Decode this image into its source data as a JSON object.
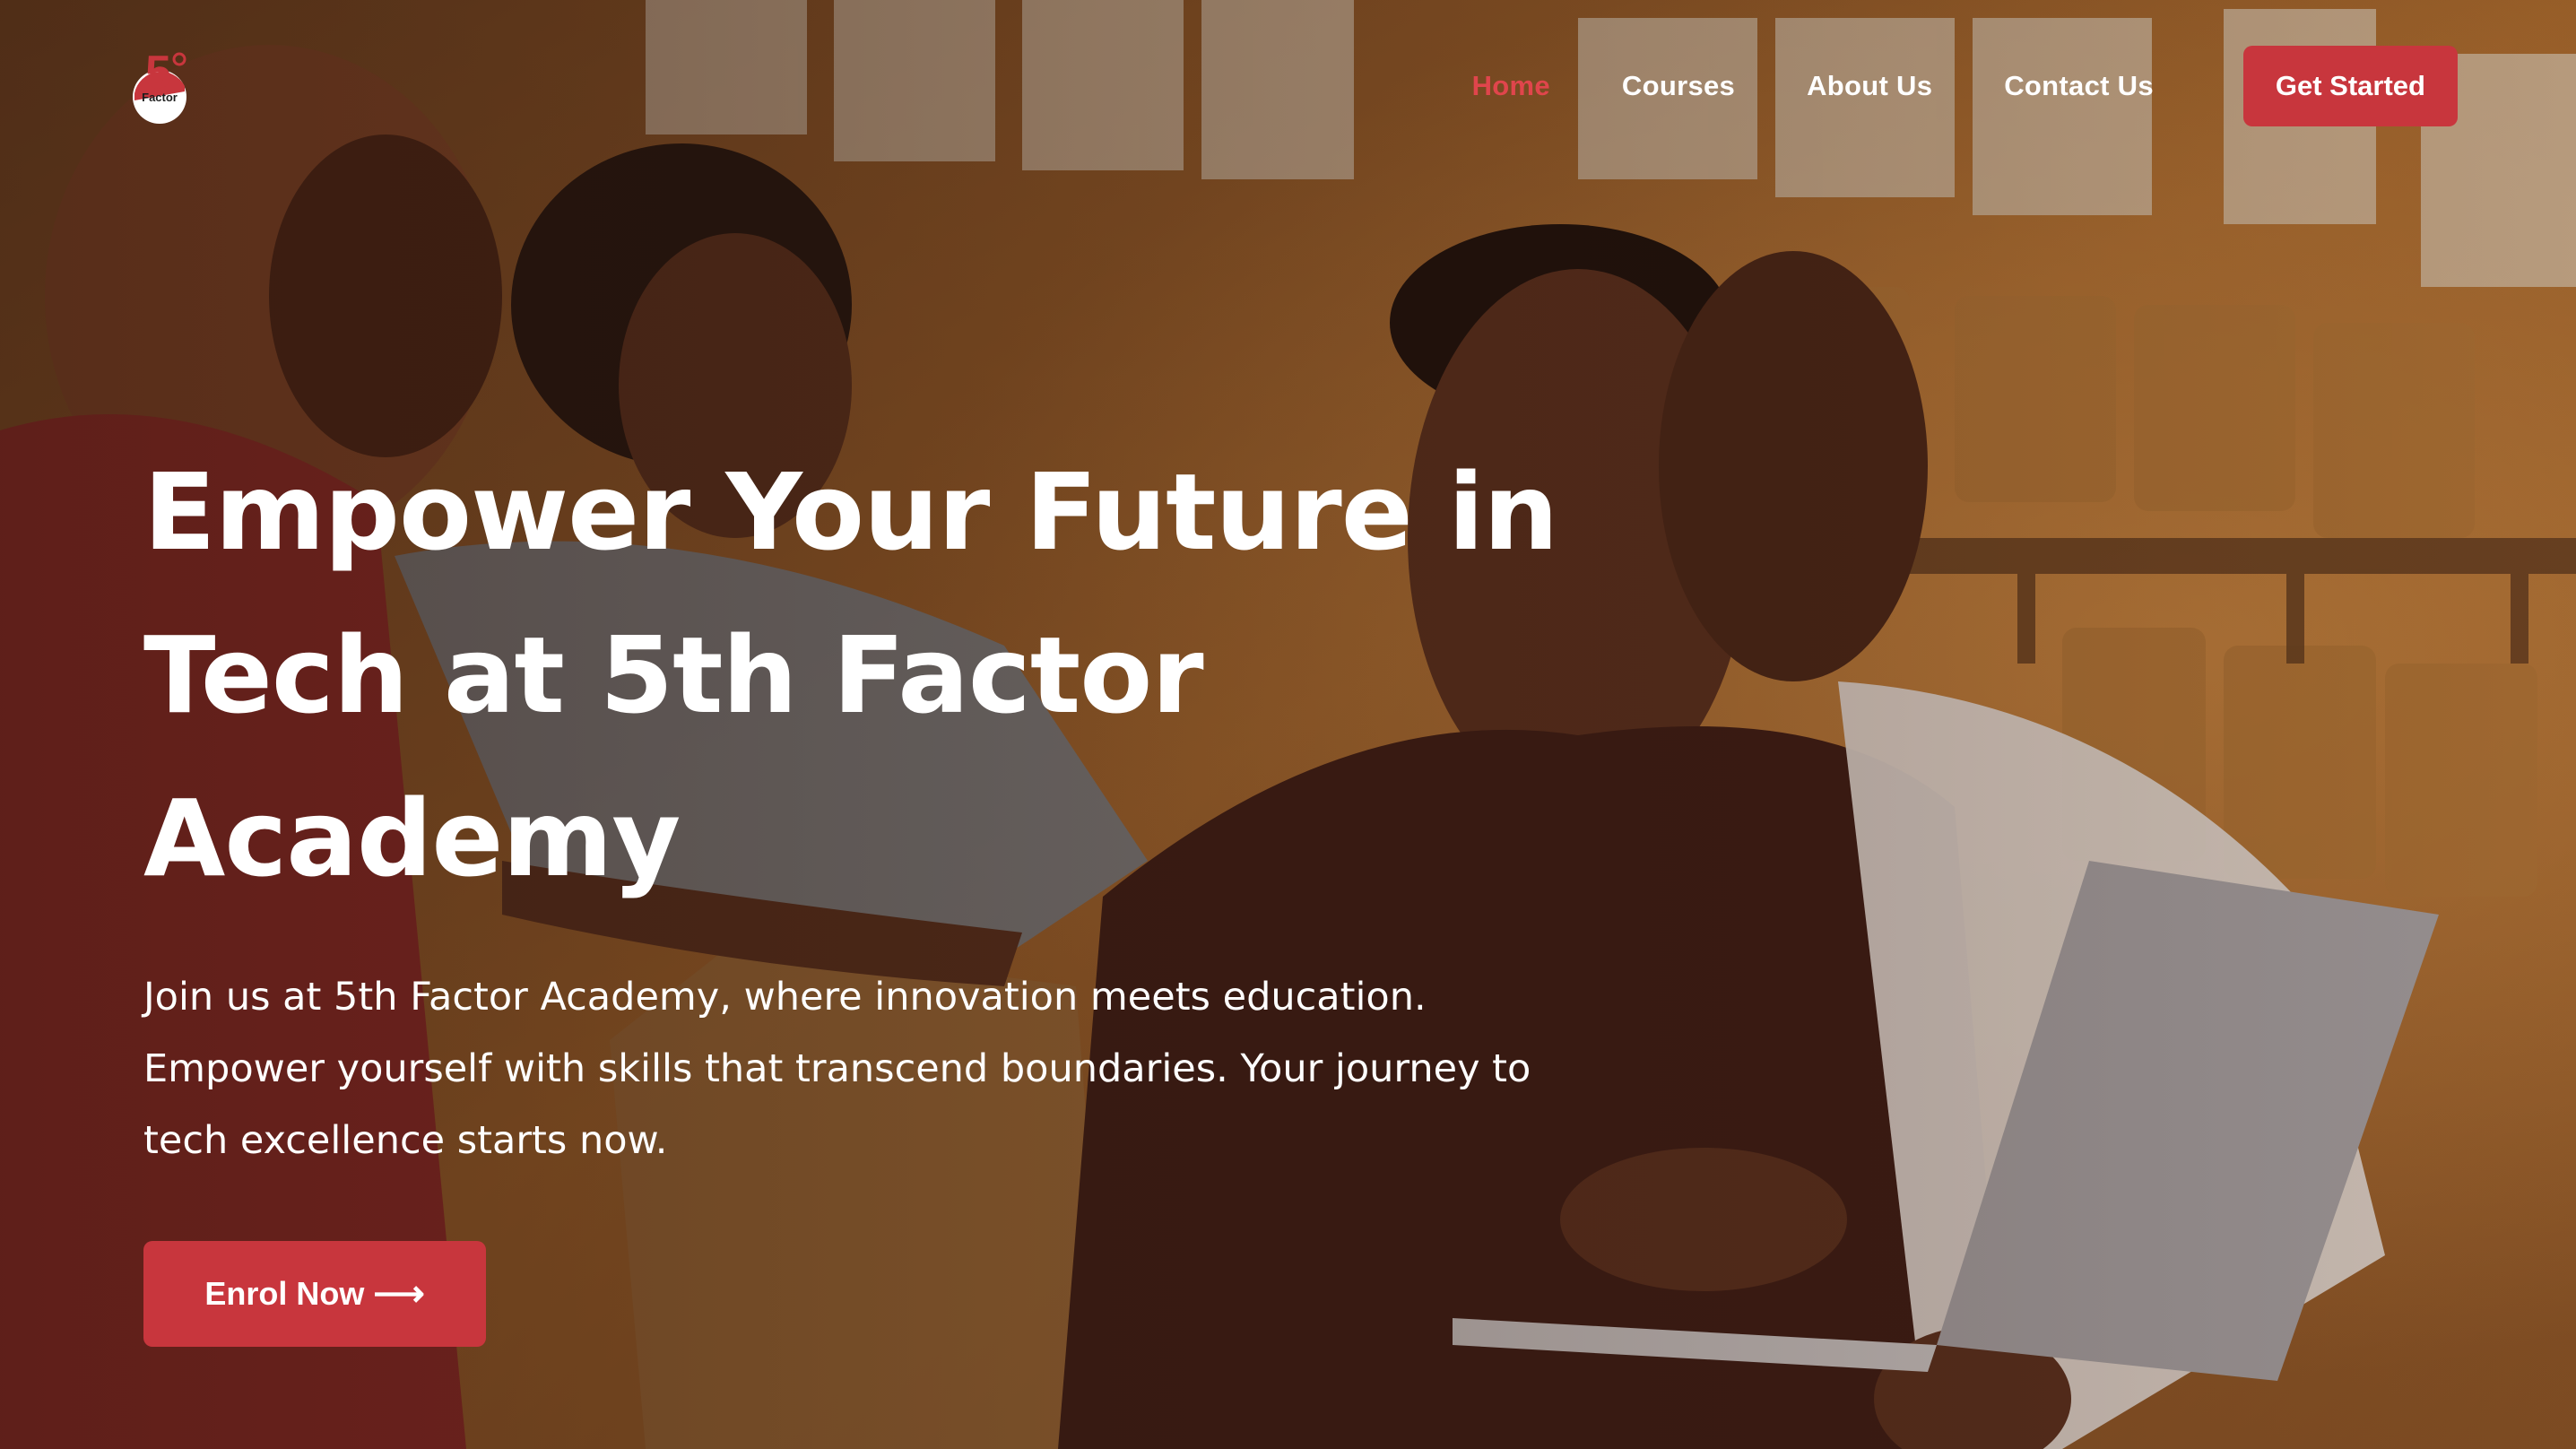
{
  "logo": {
    "numeral": "5",
    "text": "Factor"
  },
  "nav": {
    "items": [
      {
        "label": "Home",
        "active": true
      },
      {
        "label": "Courses",
        "active": false
      },
      {
        "label": "About Us",
        "active": false
      },
      {
        "label": "Contact Us",
        "active": false
      }
    ],
    "cta_label": "Get Started"
  },
  "hero": {
    "headline_lines": [
      "Empower Your Future in",
      "Tech at 5th Factor",
      "Academy"
    ],
    "subtext_lines": [
      "Join us at 5th Factor Academy, where innovation meets education.",
      "Empower yourself with skills that transcend boundaries. Your journey to",
      "tech excellence starts now."
    ],
    "cta_label": "Enrol Now",
    "cta_icon": "arrow-right-icon"
  },
  "colors": {
    "accent": "#c8363d",
    "active_link": "#e0454c",
    "text": "#ffffff"
  }
}
